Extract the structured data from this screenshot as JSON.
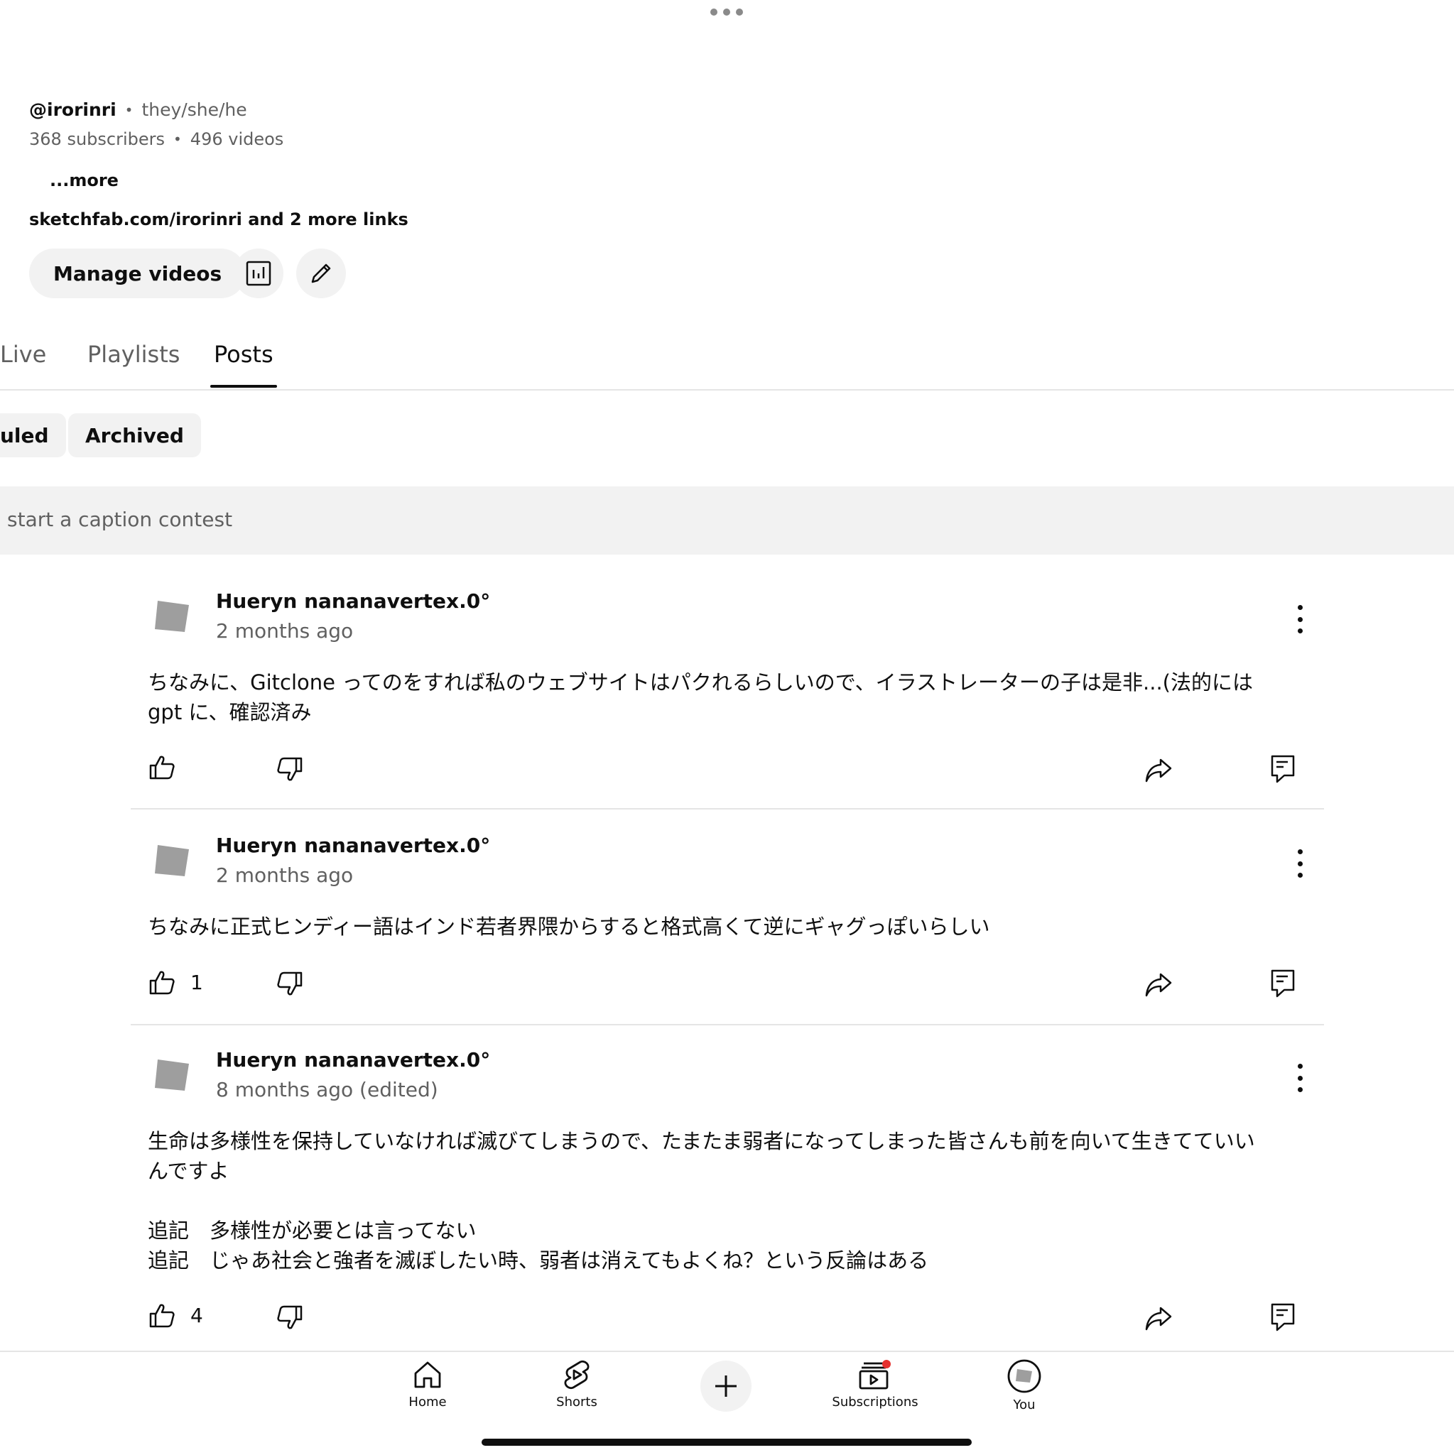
{
  "channel": {
    "handle": "@irorinri",
    "pronouns": "they/she/he",
    "subscribers": "368 subscribers",
    "videos": "496 videos",
    "more": "...more",
    "links": "sketchfab.com/irorinri and 2 more links",
    "manage_videos": "Manage videos",
    "bullet": "•"
  },
  "tabs": [
    {
      "label": "Live"
    },
    {
      "label": "Playlists"
    },
    {
      "label": "Posts"
    }
  ],
  "chips": [
    {
      "label": "uled"
    },
    {
      "label": "Archived"
    }
  ],
  "banner": {
    "text": "start a caption contest"
  },
  "posts": [
    {
      "author": "Hueryn nananavertex.0°",
      "time": "2 months ago",
      "text": "ちなみに、Gitclone ってのをすれば私のウェブサイトはパクれるらしいので、イラストレーターの子は是非...(法的には\ngpt に、確認済み",
      "likes": ""
    },
    {
      "author": "Hueryn nananavertex.0°",
      "time": "2 months ago",
      "text": "ちなみに正式ヒンディー語はインド若者界隈からすると格式高くて逆にギャグっぽいらしい",
      "likes": "1"
    },
    {
      "author": "Hueryn nananavertex.0°",
      "time": "8 months ago (edited)",
      "text": "生命は多様性を保持していなければ滅びてしまうので、たまたま弱者になってしまった皆さんも前を向いて生きてていい\nんですよ\n\n追記　多様性が必要とは言ってない\n追記　じゃあ社会と強者を滅ぼしたい時、弱者は消えてもよくね？という反論はある",
      "likes": "4"
    }
  ],
  "nav": {
    "home": "Home",
    "shorts": "Shorts",
    "subscriptions": "Subscriptions",
    "you": "You"
  },
  "colors": {
    "notification_dot": "#e5302e",
    "chip_bg": "#f2f2f2",
    "secondary_text": "#606060"
  }
}
